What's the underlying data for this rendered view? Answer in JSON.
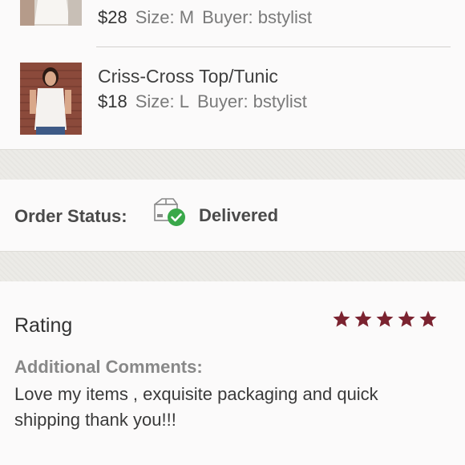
{
  "items": [
    {
      "title": "",
      "price": "$28",
      "size": "Size: M",
      "buyer": "Buyer: bstylist"
    },
    {
      "title": "Criss-Cross Top/Tunic",
      "price": "$18",
      "size": "Size: L",
      "buyer": "Buyer: bstylist"
    }
  ],
  "order_status": {
    "label": "Order Status:",
    "value": "Delivered",
    "icon": "package-delivered-icon"
  },
  "rating": {
    "label": "Rating",
    "stars": 5,
    "max_stars": 5,
    "star_color": "#7b2330"
  },
  "comments": {
    "label": "Additional Comments:",
    "text": "Love my items , exquisite packaging and quick shipping thank you!!!"
  },
  "colors": {
    "accent_green": "#3aa84a",
    "star": "#7b2330"
  }
}
